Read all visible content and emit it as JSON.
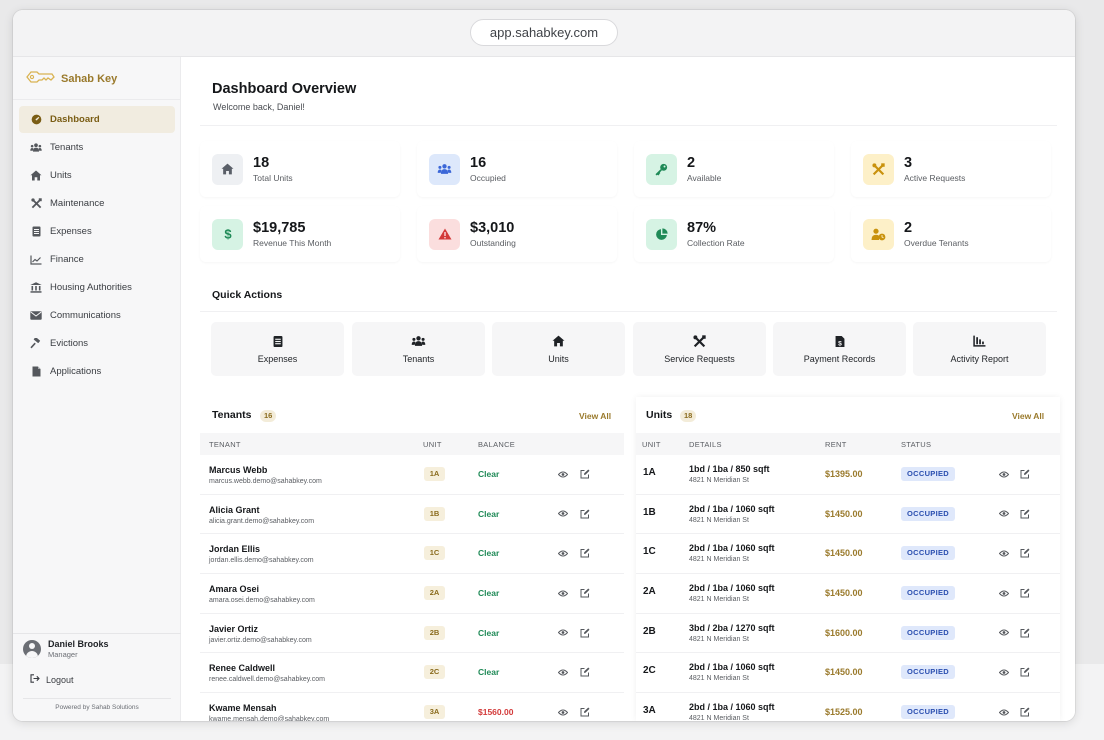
{
  "browser": {
    "url": "app.sahabkey.com"
  },
  "brand": {
    "name": "Sahab Key"
  },
  "sidebar": {
    "items": [
      {
        "label": "Dashboard",
        "icon": "dashboard-icon",
        "active": true
      },
      {
        "label": "Tenants",
        "icon": "users-icon"
      },
      {
        "label": "Units",
        "icon": "home-icon"
      },
      {
        "label": "Maintenance",
        "icon": "tools-icon"
      },
      {
        "label": "Expenses",
        "icon": "receipt-icon"
      },
      {
        "label": "Finance",
        "icon": "chart-line-icon"
      },
      {
        "label": "Housing Authorities",
        "icon": "bank-icon"
      },
      {
        "label": "Communications",
        "icon": "envelope-icon"
      },
      {
        "label": "Evictions",
        "icon": "gavel-icon"
      },
      {
        "label": "Applications",
        "icon": "file-icon"
      }
    ],
    "user": {
      "name": "Daniel Brooks",
      "role": "Manager"
    },
    "logout_label": "Logout",
    "powered_by": "Powered by Sahab Solutions"
  },
  "header": {
    "title": "Dashboard Overview",
    "subtitle": "Welcome back, Daniel!"
  },
  "stats": [
    {
      "value": "18",
      "label": "Total Units",
      "icon": "home-icon",
      "bg": "#eef0f3",
      "fg": "#5a5f68"
    },
    {
      "value": "16",
      "label": "Occupied",
      "icon": "users-icon",
      "bg": "#dde8fb",
      "fg": "#3b67d8"
    },
    {
      "value": "2",
      "label": "Available",
      "icon": "key-icon",
      "bg": "#d6f3e4",
      "fg": "#1f8a57"
    },
    {
      "value": "3",
      "label": "Active Requests",
      "icon": "tools-icon",
      "bg": "#fdf0c8",
      "fg": "#c9920d"
    },
    {
      "value": "$19,785",
      "label": "Revenue This Month",
      "icon": "dollar-icon",
      "bg": "#d6f3e4",
      "fg": "#1f8a57"
    },
    {
      "value": "$3,010",
      "label": "Outstanding",
      "icon": "warning-icon",
      "bg": "#fbdede",
      "fg": "#d33a3a"
    },
    {
      "value": "87%",
      "label": "Collection Rate",
      "icon": "pie-chart-icon",
      "bg": "#d6f3e4",
      "fg": "#1f8a57"
    },
    {
      "value": "2",
      "label": "Overdue Tenants",
      "icon": "user-clock-icon",
      "bg": "#fdf0c8",
      "fg": "#c9920d"
    }
  ],
  "quick_actions": {
    "title": "Quick Actions",
    "items": [
      {
        "label": "Expenses",
        "icon": "receipt-icon"
      },
      {
        "label": "Tenants",
        "icon": "users-icon"
      },
      {
        "label": "Units",
        "icon": "home-icon"
      },
      {
        "label": "Service Requests",
        "icon": "tools-icon"
      },
      {
        "label": "Payment Records",
        "icon": "invoice-dollar-icon"
      },
      {
        "label": "Activity Report",
        "icon": "chart-bar-icon"
      }
    ]
  },
  "tenants": {
    "title": "Tenants",
    "count": "16",
    "view_all": "View All",
    "columns": {
      "tenant": "TENANT",
      "unit": "UNIT",
      "balance": "BALANCE"
    },
    "rows": [
      {
        "name": "Marcus Webb",
        "email": "marcus.webb.demo@sahabkey.com",
        "unit": "1A",
        "balance": "Clear",
        "overdue": false
      },
      {
        "name": "Alicia Grant",
        "email": "alicia.grant.demo@sahabkey.com",
        "unit": "1B",
        "balance": "Clear",
        "overdue": false
      },
      {
        "name": "Jordan Ellis",
        "email": "jordan.ellis.demo@sahabkey.com",
        "unit": "1C",
        "balance": "Clear",
        "overdue": false
      },
      {
        "name": "Amara Osei",
        "email": "amara.osei.demo@sahabkey.com",
        "unit": "2A",
        "balance": "Clear",
        "overdue": false
      },
      {
        "name": "Javier Ortiz",
        "email": "javier.ortiz.demo@sahabkey.com",
        "unit": "2B",
        "balance": "Clear",
        "overdue": false
      },
      {
        "name": "Renee Caldwell",
        "email": "renee.caldwell.demo@sahabkey.com",
        "unit": "2C",
        "balance": "Clear",
        "overdue": false
      },
      {
        "name": "Kwame Mensah",
        "email": "kwame.mensah.demo@sahabkey.com",
        "unit": "3A",
        "balance": "$1560.00",
        "overdue": true
      }
    ]
  },
  "units": {
    "title": "Units",
    "count": "18",
    "view_all": "View All",
    "columns": {
      "unit": "UNIT",
      "details": "DETAILS",
      "rent": "RENT",
      "status": "STATUS"
    },
    "rows": [
      {
        "unit": "1A",
        "details": "1bd / 1ba / 850 sqft",
        "address": "4821 N Meridian St",
        "rent": "$1395.00",
        "status": "OCCUPIED"
      },
      {
        "unit": "1B",
        "details": "2bd / 1ba / 1060 sqft",
        "address": "4821 N Meridian St",
        "rent": "$1450.00",
        "status": "OCCUPIED"
      },
      {
        "unit": "1C",
        "details": "2bd / 1ba / 1060 sqft",
        "address": "4821 N Meridian St",
        "rent": "$1450.00",
        "status": "OCCUPIED"
      },
      {
        "unit": "2A",
        "details": "2bd / 1ba / 1060 sqft",
        "address": "4821 N Meridian St",
        "rent": "$1450.00",
        "status": "OCCUPIED"
      },
      {
        "unit": "2B",
        "details": "3bd / 2ba / 1270 sqft",
        "address": "4821 N Meridian St",
        "rent": "$1600.00",
        "status": "OCCUPIED"
      },
      {
        "unit": "2C",
        "details": "2bd / 1ba / 1060 sqft",
        "address": "4821 N Meridian St",
        "rent": "$1450.00",
        "status": "OCCUPIED"
      },
      {
        "unit": "3A",
        "details": "2bd / 1ba / 1060 sqft",
        "address": "4821 N Meridian St",
        "rent": "$1525.00",
        "status": "OCCUPIED"
      }
    ]
  },
  "colors": {
    "accent": "#9a7a2c",
    "clear": "#1f8a57",
    "overdue": "#d33a3a"
  }
}
